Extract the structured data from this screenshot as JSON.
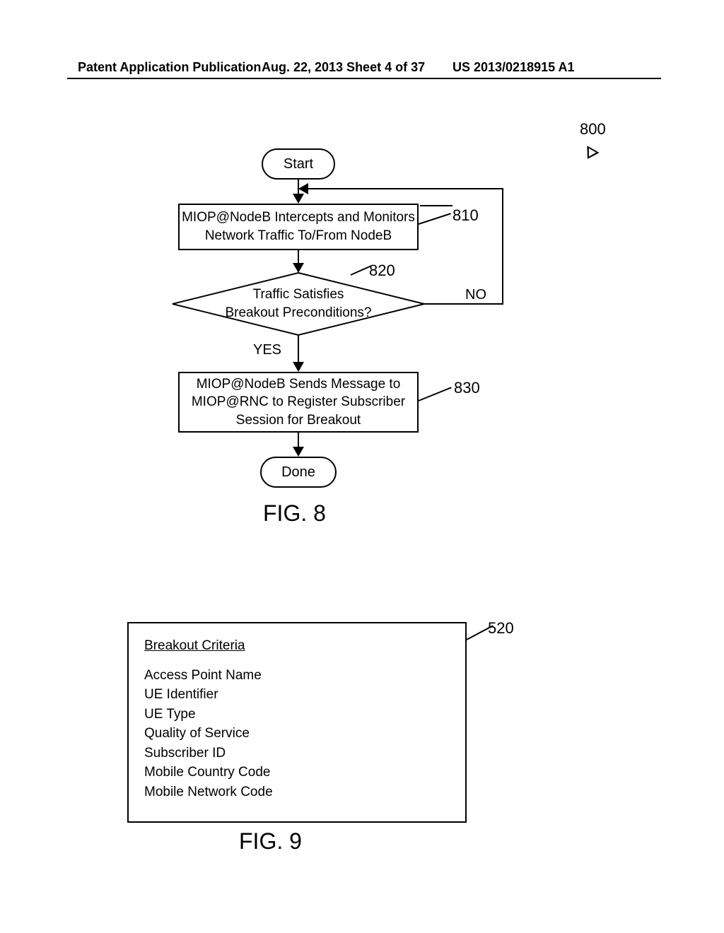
{
  "header": {
    "left": "Patent Application Publication",
    "mid": "Aug. 22, 2013  Sheet 4 of 37",
    "right": "US 2013/0218915 A1"
  },
  "fig8": {
    "ref": "800",
    "start": "Start",
    "step810": {
      "ref": "810",
      "text": "MIOP@NodeB Intercepts and Monitors\nNetwork Traffic To/From NodeB"
    },
    "decision820": {
      "ref": "820",
      "text": "Traffic Satisfies\nBreakout Preconditions?",
      "yes": "YES",
      "no": "NO"
    },
    "step830": {
      "ref": "830",
      "text": "MIOP@NodeB Sends Message to\nMIOP@RNC to Register Subscriber\nSession for Breakout"
    },
    "done": "Done",
    "caption": "FIG. 8"
  },
  "fig9": {
    "ref": "520",
    "title": "Breakout Criteria",
    "items": [
      "Access Point Name",
      "UE Identifier",
      "UE Type",
      "Quality of Service",
      "Subscriber ID",
      "Mobile Country Code",
      "Mobile Network Code"
    ],
    "caption": "FIG. 9"
  }
}
